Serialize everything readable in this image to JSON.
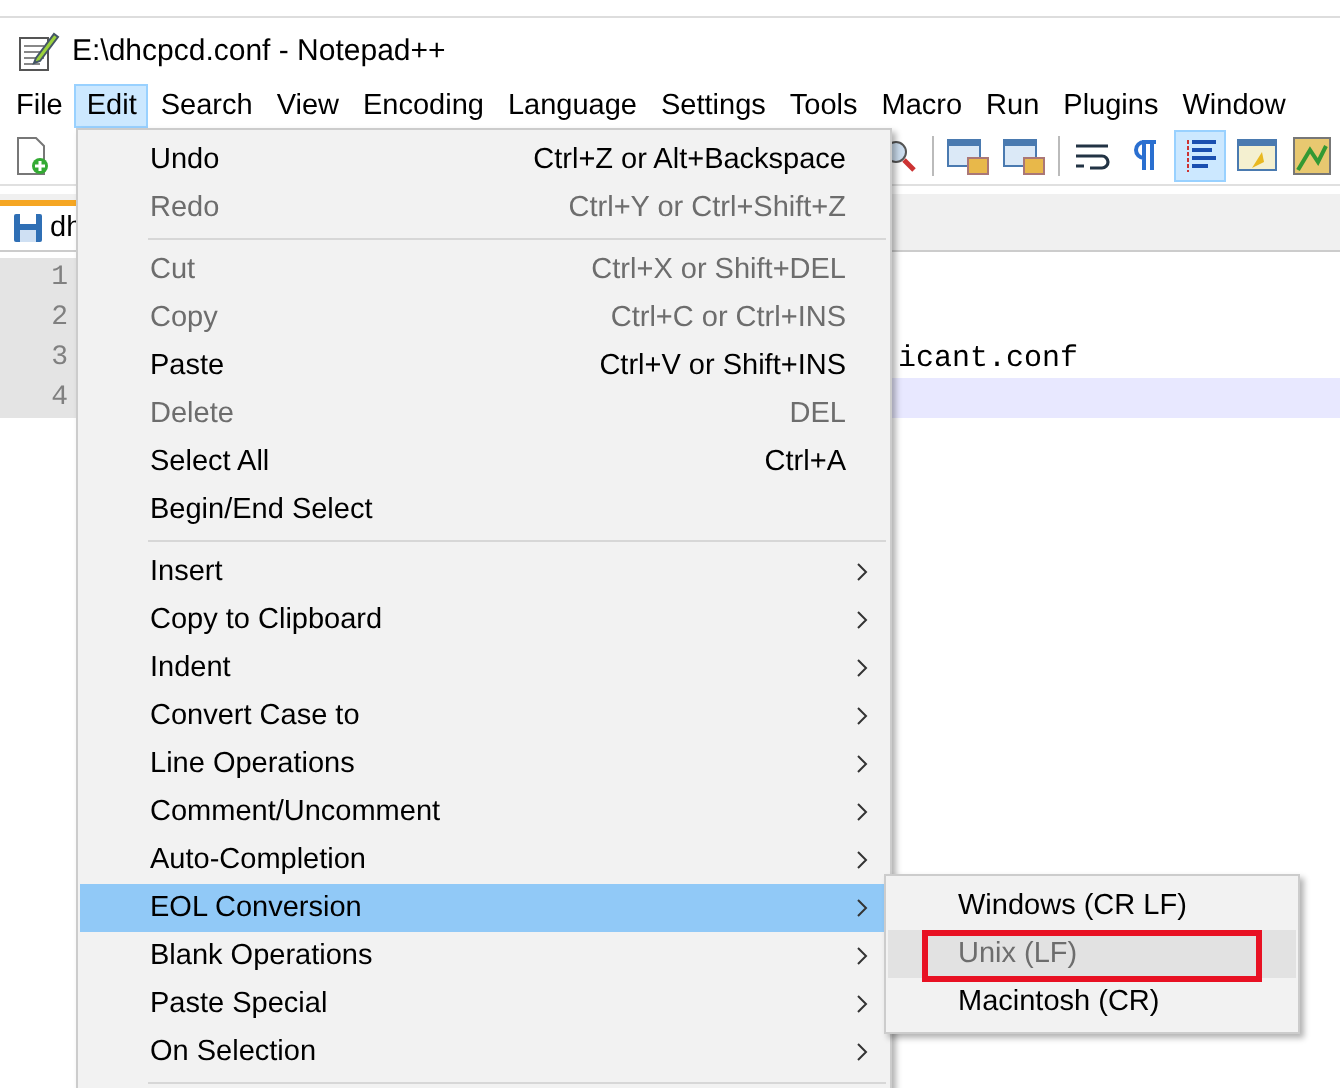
{
  "window": {
    "title": "E:\\dhcpcd.conf - Notepad++"
  },
  "menu_bar": [
    {
      "label": "File",
      "selected": false
    },
    {
      "label": "Edit",
      "selected": true
    },
    {
      "label": "Search",
      "selected": false
    },
    {
      "label": "View",
      "selected": false
    },
    {
      "label": "Encoding",
      "selected": false
    },
    {
      "label": "Language",
      "selected": false
    },
    {
      "label": "Settings",
      "selected": false
    },
    {
      "label": "Tools",
      "selected": false
    },
    {
      "label": "Macro",
      "selected": false
    },
    {
      "label": "Run",
      "selected": false
    },
    {
      "label": "Plugins",
      "selected": false
    },
    {
      "label": "Window",
      "selected": false
    }
  ],
  "tab": {
    "label": "dh"
  },
  "editor": {
    "lines": [
      {
        "number": "1",
        "current": false
      },
      {
        "number": "2",
        "current": false
      },
      {
        "number": "3",
        "text": "icant.conf",
        "current": false
      },
      {
        "number": "4",
        "current": true
      }
    ]
  },
  "edit_menu": [
    {
      "kind": "item",
      "label": "Undo",
      "shortcut": "Ctrl+Z or Alt+Backspace",
      "disabled": false,
      "selected": false
    },
    {
      "kind": "item",
      "label": "Redo",
      "shortcut": "Ctrl+Y or Ctrl+Shift+Z",
      "disabled": true,
      "selected": false
    },
    {
      "kind": "separator"
    },
    {
      "kind": "item",
      "label": "Cut",
      "shortcut": "Ctrl+X or Shift+DEL",
      "disabled": true,
      "selected": false
    },
    {
      "kind": "item",
      "label": "Copy",
      "shortcut": "Ctrl+C or Ctrl+INS",
      "disabled": true,
      "selected": false
    },
    {
      "kind": "item",
      "label": "Paste",
      "shortcut": "Ctrl+V or Shift+INS",
      "disabled": false,
      "selected": false
    },
    {
      "kind": "item",
      "label": "Delete",
      "shortcut": "DEL",
      "disabled": true,
      "selected": false
    },
    {
      "kind": "item",
      "label": "Select All",
      "shortcut": "Ctrl+A",
      "disabled": false,
      "selected": false
    },
    {
      "kind": "item",
      "label": "Begin/End Select",
      "disabled": false,
      "selected": false
    },
    {
      "kind": "separator"
    },
    {
      "kind": "submenu",
      "label": "Insert",
      "disabled": false,
      "selected": false
    },
    {
      "kind": "submenu",
      "label": "Copy to Clipboard",
      "disabled": false,
      "selected": false
    },
    {
      "kind": "submenu",
      "label": "Indent",
      "disabled": false,
      "selected": false
    },
    {
      "kind": "submenu",
      "label": "Convert Case to",
      "disabled": false,
      "selected": false
    },
    {
      "kind": "submenu",
      "label": "Line Operations",
      "disabled": false,
      "selected": false
    },
    {
      "kind": "submenu",
      "label": "Comment/Uncomment",
      "disabled": false,
      "selected": false
    },
    {
      "kind": "submenu",
      "label": "Auto-Completion",
      "disabled": false,
      "selected": false
    },
    {
      "kind": "submenu",
      "label": "EOL Conversion",
      "disabled": false,
      "selected": true
    },
    {
      "kind": "submenu",
      "label": "Blank Operations",
      "disabled": false,
      "selected": false
    },
    {
      "kind": "submenu",
      "label": "Paste Special",
      "disabled": false,
      "selected": false
    },
    {
      "kind": "submenu",
      "label": "On Selection",
      "disabled": false,
      "selected": false
    },
    {
      "kind": "separator"
    }
  ],
  "eol_submenu": [
    {
      "label": "Windows (CR LF)",
      "disabled": false,
      "selected": false,
      "marked": false
    },
    {
      "label": "Unix (LF)",
      "disabled": true,
      "selected": true,
      "marked": true
    },
    {
      "label": "Macintosh (CR)",
      "disabled": false,
      "selected": false,
      "marked": false
    }
  ]
}
